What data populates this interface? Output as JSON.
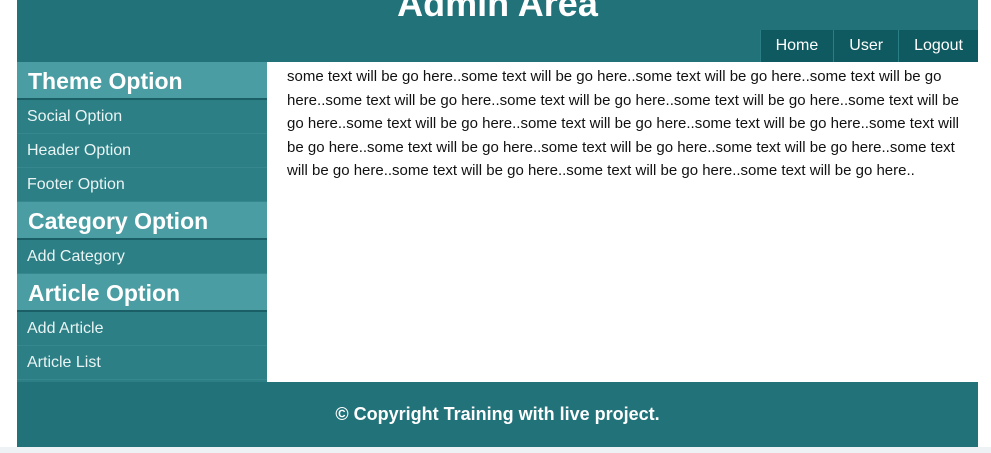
{
  "header": {
    "title": "Admin Area",
    "nav": [
      {
        "label": "Home"
      },
      {
        "label": "User"
      },
      {
        "label": "Logout"
      }
    ]
  },
  "sidebar": {
    "sections": [
      {
        "title": "Theme Option",
        "items": [
          "Social Option",
          "Header Option",
          "Footer Option"
        ]
      },
      {
        "title": "Category Option",
        "items": [
          "Add Category"
        ]
      },
      {
        "title": "Article Option",
        "items": [
          "Add Article",
          "Article List"
        ]
      }
    ]
  },
  "content": {
    "text": "some text will be go here..some text will be go here..some text will be go here..some text will be go here..some text will be go here..some text will be go here..some text will be go here..some text will be go here..some text will be go here..some text will be go here..some text will be go here..some text will be go here..some text will be go here..some text will be go here..some text will be go here..some text will be go here..some text will be go here..some text will be go here..some text will be go here.."
  },
  "footer": {
    "text": "© Copyright Training with live project."
  },
  "colors": {
    "header_bg": "#22727a",
    "nav_bg": "#0f5a60",
    "sidebar_bg": "#2b7f85",
    "section_bg": "#4a9da2"
  }
}
